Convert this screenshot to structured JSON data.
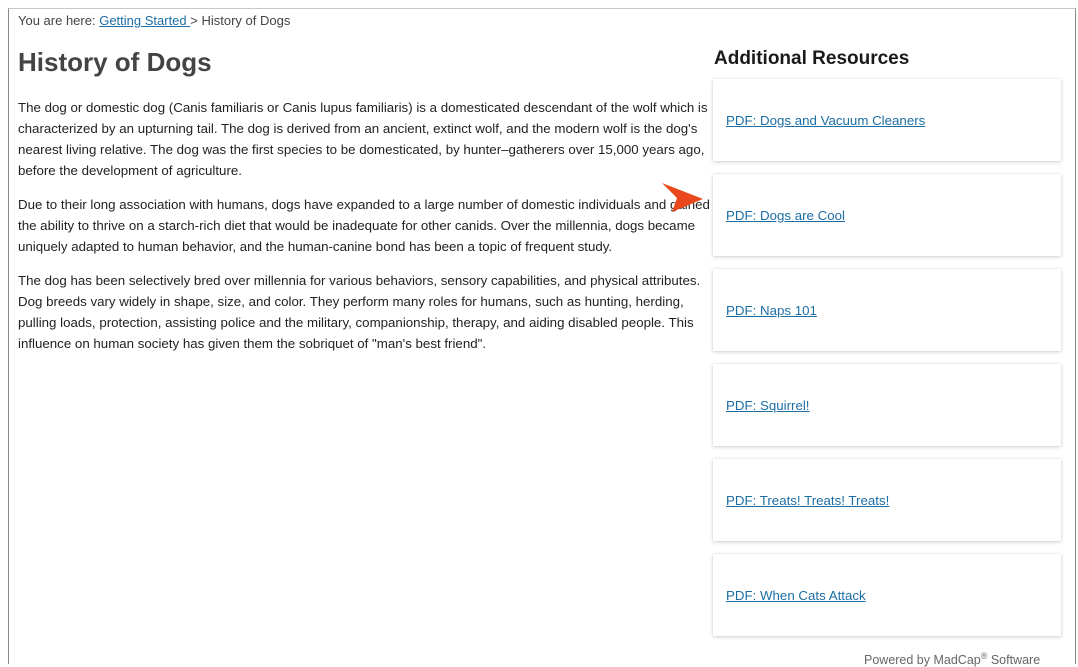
{
  "breadcrumb": {
    "prefix": "You are here: ",
    "link": "Getting Started ",
    "separator": "> ",
    "current": "History of Dogs"
  },
  "page": {
    "title": "History of Dogs",
    "paragraphs": [
      "The dog or domestic dog (Canis familiaris or Canis lupus familiaris) is a domesticated descendant of the wolf which is characterized by an upturning tail. The dog is derived from an ancient, extinct wolf, and the modern wolf is the dog's nearest living relative. The dog was the first species to be domesticated, by hunter–gatherers over 15,000 years ago, before the development of agriculture.",
      "Due to their long association with humans, dogs have expanded to a large number of domestic individuals and gained the ability to thrive on a starch-rich diet that would be inadequate for other canids. Over the millennia, dogs became uniquely adapted to human behavior, and the human-canine bond has been a topic of frequent study.",
      "The dog has been selectively bred over millennia for various behaviors, sensory capabilities, and physical attributes. Dog breeds vary widely in shape, size, and color. They perform many roles for humans, such as hunting, herding, pulling loads, protection, assisting police and the military, companionship, therapy, and aiding disabled people. This influence on human society has given them the sobriquet of \"man's best friend\"."
    ]
  },
  "resources": {
    "title": "Additional Resources",
    "items": [
      {
        "label": "PDF: Dogs and Vacuum Cleaners"
      },
      {
        "label": "PDF: Dogs are Cool"
      },
      {
        "label": "PDF: Naps 101"
      },
      {
        "label": "PDF: Squirrel!"
      },
      {
        "label": "PDF: Treats! Treats! Treats!"
      },
      {
        "label": "PDF: When Cats Attack"
      }
    ]
  },
  "pointer": {
    "icon": "arrow-pointer-icon",
    "color": "#e8481c"
  },
  "footer": {
    "prefix": "Powered by MadCap",
    "mark": "®",
    "suffix": " Software"
  },
  "colors": {
    "link": "#1c6ea4",
    "title": "#444444"
  }
}
